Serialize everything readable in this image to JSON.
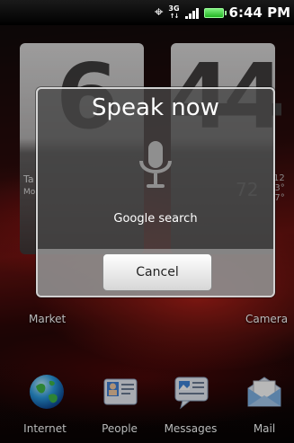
{
  "status_bar": {
    "network_type": "3G",
    "time": "6:44 PM"
  },
  "home": {
    "clock_widget": {
      "hour_digit": "6",
      "minute_digit": "4",
      "side_text_line1": "Ta",
      "side_text_line2": "Mo",
      "temp_main": "72",
      "temp_high": "12",
      "temp_low1": "3°",
      "temp_low2": "7°"
    },
    "shortcut_left": "Market",
    "shortcut_right": "Camera",
    "dock": [
      {
        "label": "Internet",
        "icon": "globe-icon"
      },
      {
        "label": "People",
        "icon": "contact-card-icon"
      },
      {
        "label": "Messages",
        "icon": "message-icon"
      },
      {
        "label": "Mail",
        "icon": "mail-icon"
      }
    ]
  },
  "dialog": {
    "title": "Speak now",
    "subtitle": "Google search",
    "cancel_label": "Cancel",
    "icon": "microphone-icon"
  },
  "colors": {
    "dialog_background": "#464646",
    "accent_battery": "#22b522"
  }
}
